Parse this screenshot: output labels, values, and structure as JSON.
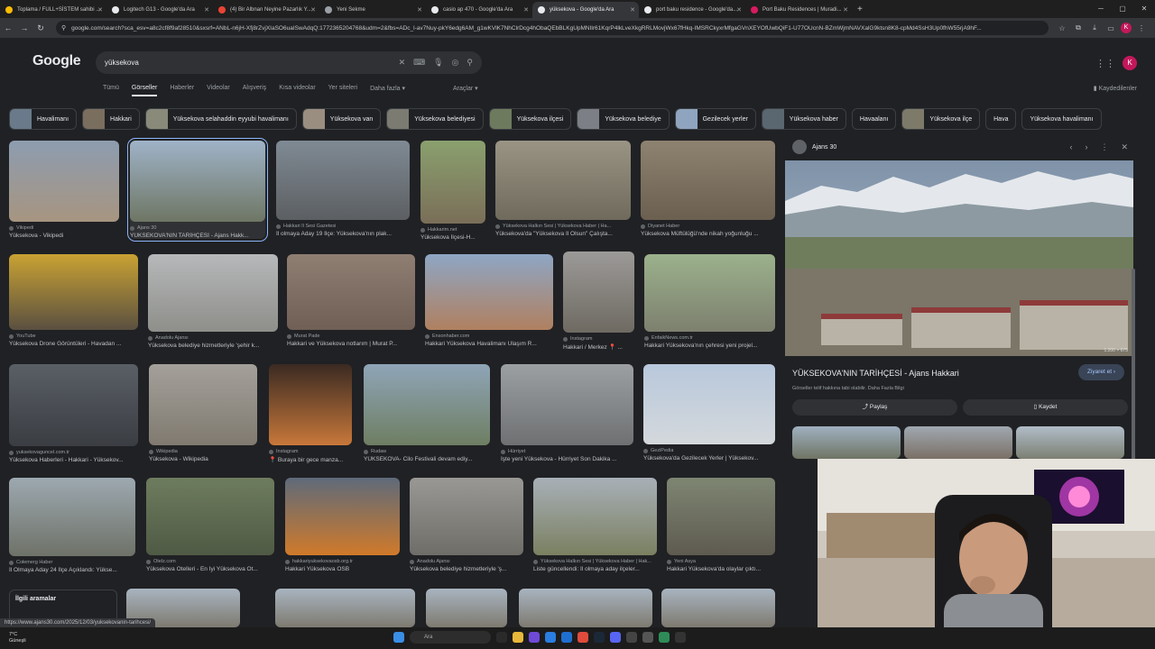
{
  "browser": {
    "tabs": [
      {
        "label": "Toplama / FULL+SİSTEM sahibi ...",
        "color": "#fbbc04",
        "active": false
      },
      {
        "label": "Logitech G13 - Google'da Ara",
        "color": "#e8eaed",
        "active": false
      },
      {
        "label": "(4) Bir Albnan Neyine Pazarlık Y...",
        "color": "#ea4335",
        "active": false
      },
      {
        "label": "Yeni Sekme",
        "color": "#9aa0a6",
        "active": false
      },
      {
        "label": "casio ap 470 - Google'da Ara",
        "color": "#e8eaed",
        "active": false
      },
      {
        "label": "yüksekova - Google'da Ara",
        "color": "#e8eaed",
        "active": true
      },
      {
        "label": "port baku residence - Google'da...",
        "color": "#e8eaed",
        "active": false
      },
      {
        "label": "Port Baku Residences | Muradi...",
        "color": "#d81b60",
        "active": false
      }
    ],
    "new_tab": "+",
    "url": "google.com/search?sca_esv=a8c2cf8f9af28510&sxsrf=ANbL-n6jH-Xfj8rZvjXIaSO6uaISwAdqQ:1772365204768&udm=2&fbs=ADc_l-av7Nuy-pkY6edg6AM_g1wKVlK7NhClrDcg4hObaQEbBLKgUpMNIlr61KqrP4lkLveXkgRRLMovjWx67fHkq-IMSRCkyxrMfgaGVnXEYOfUwbQiF1-U77OUcnN-BZmWjmNAVXalG9ktsn8K8-cpMd4SsH3Up0fhW55rjA9hF...",
    "avatar_letter": "K"
  },
  "google": {
    "logo": "Google",
    "query": "yüksekova",
    "tabs": [
      "Tümü",
      "Görseller",
      "Haberler",
      "Videolar",
      "Alışveriş",
      "Kısa videolar",
      "Yer siteleri",
      "Daha fazla ▾"
    ],
    "tools": "Araçlar ▾",
    "saved": "Kaydedilenler",
    "avatar_letter": "K"
  },
  "chips": [
    {
      "label": "Havalimanı",
      "img": true,
      "color": "#6a7a8a"
    },
    {
      "label": "Hakkari",
      "img": true,
      "color": "#7a6e5e"
    },
    {
      "label": "Yüksekova selahaddin eyyubi havalimanı",
      "img": true,
      "color": "#8a8a7a"
    },
    {
      "label": "Yüksekova van",
      "img": true,
      "color": "#9a8e80"
    },
    {
      "label": "Yüksekova belediyesi",
      "img": true,
      "color": "#7b7b72"
    },
    {
      "label": "Yüksekova ilçesi",
      "img": true,
      "color": "#6e7a5e"
    },
    {
      "label": "Yüksekova belediye",
      "img": true,
      "color": "#7c7f86"
    },
    {
      "label": "Gezilecek yerler",
      "img": true,
      "color": "#8fa4bf"
    },
    {
      "label": "Yüksekova haber",
      "img": true,
      "color": "#5a6670"
    },
    {
      "label": "Havaalanı",
      "img": false
    },
    {
      "label": "Yüksekova ilçe",
      "img": true,
      "color": "#7d7a6a"
    },
    {
      "label": "Hava",
      "img": false
    },
    {
      "label": "Yüksekova havalimanı",
      "img": false
    }
  ],
  "results": [
    {
      "src": "Vikipedi",
      "cap": "Yüksekova - Vikipedi",
      "c1": "#8d9cb0",
      "c2": "#a79580"
    },
    {
      "src": "Ajans 30",
      "cap": "YÜKSEKOVA'NIN TARİHÇESİ - Ajans Hakk...",
      "c1": "#9fb3c8",
      "c2": "#6e7664",
      "selected": true
    },
    {
      "src": "Hakkari İl Sesi Gazetesi",
      "cap": "İl olmaya Aday 19 İlçe: Yüksekova'nın plak...",
      "c1": "#7f8a94",
      "c2": "#5c5f62"
    },
    {
      "src": "Hakkarim.net",
      "cap": "Yüksekova İlçesi-H...",
      "c1": "#8aa06e",
      "c2": "#7a6e58"
    },
    {
      "src": "Yüksekova Halkın Sesi | Yüksekova Haber | Ha...",
      "cap": "Yüksekova'da \"Yüksekova İl Olsun\" Çalışta...",
      "c1": "#9a9484",
      "c2": "#6f6a5c"
    },
    {
      "src": "Diyanet Haber",
      "cap": "Yüksekova Müftülüğü'nde nikah yoğunluğu ...",
      "c1": "#8e8270",
      "c2": "#6b5f50"
    },
    {
      "src": "YouTube",
      "cap": "Yüksekova Drone Görüntüleri - Havadan ...",
      "c1": "#c9a233",
      "c2": "#5a5040"
    },
    {
      "src": "Anadolu Ajansı",
      "cap": "Yüksekova belediye hizmetleriyle 'şehir k...",
      "c1": "#b6b8ba",
      "c2": "#8e8f8a"
    },
    {
      "src": "Murat Pade",
      "cap": "Hakkari ve Yüksekova notlarım | Murat P...",
      "c1": "#8f7e72",
      "c2": "#6f5f55"
    },
    {
      "src": "Ensonhaber.com",
      "cap": "Hakkari Yüksekova Havalimanı Ulaşım R...",
      "c1": "#8ea6c4",
      "c2": "#b08060"
    },
    {
      "src": "Instagram",
      "cap": "Hakkari / Merkez 📍 ...",
      "c1": "#9c9a98",
      "c2": "#6e6a62"
    },
    {
      "src": "EnfaikNews.com.tr",
      "cap": "Hakkari Yüksekova'nın çehresi yeni projel...",
      "c1": "#9bb18c",
      "c2": "#7d806e"
    },
    {
      "src": "yuksekovaguncel.com.tr",
      "cap": "Yüksekova Haberleri - Hakkari - Yüksekov...",
      "c1": "#5a5f66",
      "c2": "#3a3d42"
    },
    {
      "src": "Wikipedia",
      "cap": "Yüksekova - Wikipedia",
      "c1": "#a4a09a",
      "c2": "#807a70"
    },
    {
      "src": "Instagram",
      "cap": "📍 Buraya bir gece manza...",
      "c1": "#3a2a22",
      "c2": "#c8783a"
    },
    {
      "src": "Rudaw",
      "cap": "YÜKSEKOVA- Cilo Festivali devam ediy...",
      "c1": "#8fa5b8",
      "c2": "#6e7e62"
    },
    {
      "src": "Hürriyet",
      "cap": "İşte yeni Yüksekova - Hürriyet Son Dakika ...",
      "c1": "#9ca0a2",
      "c2": "#6e7072"
    },
    {
      "src": "GeziPedia",
      "cap": "Yüksekova'da Gezilecek Yerler | Yüksekov...",
      "c1": "#b8c8dc",
      "c2": "#d4d8dc"
    },
    {
      "src": "Cołemerg Haber",
      "cap": "İl Olmaya Aday 24 İlçe Açıklandı: Yükse...",
      "c1": "#9da8b0",
      "c2": "#6e7268"
    },
    {
      "src": "Otelz.com",
      "cap": "Yüksekova Otelleri - En İyi Yüksekova Ot...",
      "c1": "#6e7c5e",
      "c2": "#4f5a44"
    },
    {
      "src": "hakkariyuksekovaosb.org.tr",
      "cap": "Hakkari Yüksekova OSB",
      "c1": "#5e6a7a",
      "c2": "#d07a2a"
    },
    {
      "src": "Anadolu Ajansı",
      "cap": "Yüksekova belediye hizmetleriyle 'ş...",
      "c1": "#9a9894",
      "c2": "#6f6d68"
    },
    {
      "src": "Yüksekova Halkın Sesi | Yüksekova Haber | Hak...",
      "cap": "Liste güncellendi: İl olmaya aday ilçeler...",
      "c1": "#a8b0b8",
      "c2": "#7a8060"
    },
    {
      "src": "Yeni Asya",
      "cap": "Hakkari Yüksekova'da olaylar çıktı...",
      "c1": "#7e8672",
      "c2": "#5e5a50"
    }
  ],
  "related_searches": "İlgili aramalar",
  "status_url": "https://www.ajans30.com/2025/12/03/yuksekovanin-tarihcesi/",
  "panel": {
    "site": "Ajans 30",
    "title": "YÜKSEKOVA'NIN TARİHÇESİ - Ajans Hakkari",
    "visit": "Ziyaret et ›",
    "note": "Görseller telif hakkına tabi olabilir.",
    "note_link": "Daha Fazla Bilgi",
    "share": "Paylaş",
    "save": "Kaydet",
    "img_dims": "1.200 × 675"
  },
  "taskbar": {
    "temp": "7°C",
    "weather": "Güneşli",
    "search": "Ara"
  }
}
